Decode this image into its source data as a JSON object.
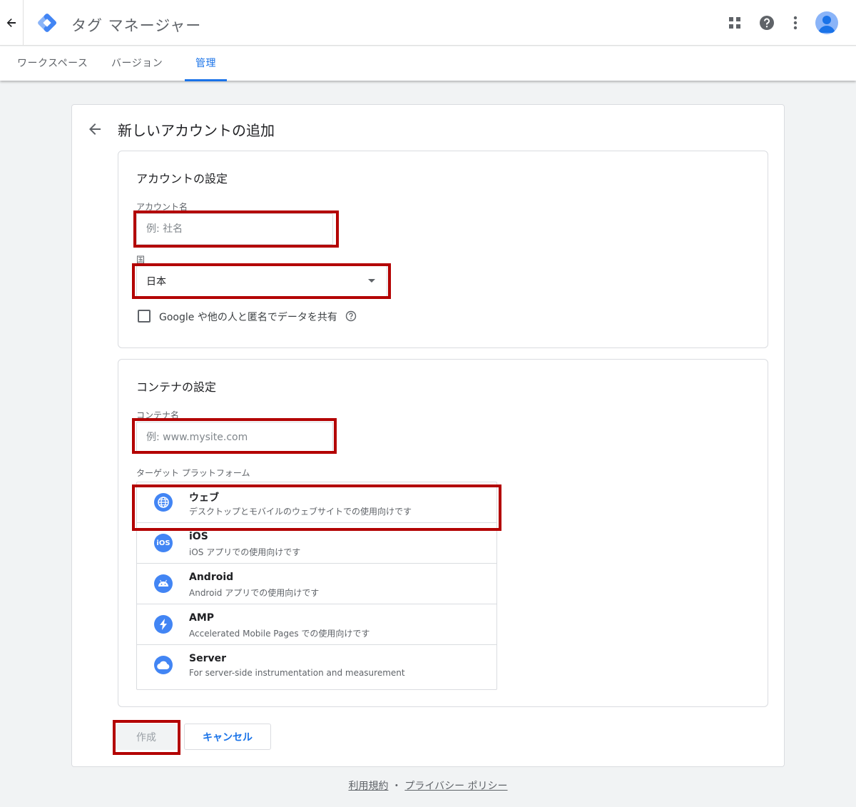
{
  "header": {
    "app_title": "タグ マネージャー",
    "icons": [
      "back-arrow-icon",
      "tag-manager-logo",
      "apps-grid-icon",
      "help-icon",
      "more-vert-icon",
      "avatar"
    ]
  },
  "tabs": [
    {
      "label": "ワークスペース",
      "active": false
    },
    {
      "label": "バージョン",
      "active": false
    },
    {
      "label": "管理",
      "active": true
    }
  ],
  "page": {
    "title": "新しいアカウントの追加"
  },
  "account_section": {
    "title": "アカウントの設定",
    "account_name_label": "アカウント名",
    "account_name_value": "",
    "account_name_placeholder": "例: 社名",
    "country_label": "国",
    "country_value": "日本",
    "share_label": "Google や他の人と匿名でデータを共有",
    "share_checked": false
  },
  "container_section": {
    "title": "コンテナの設定",
    "container_name_label": "コンテナ名",
    "container_name_value": "",
    "container_name_placeholder": "例: www.mysite.com",
    "platform_label": "ターゲット プラットフォーム",
    "platforms": [
      {
        "name": "ウェブ",
        "desc": "デスクトップとモバイルのウェブサイトでの使用向けです",
        "icon": "globe-icon"
      },
      {
        "name": "iOS",
        "desc": "iOS アプリでの使用向けです",
        "icon": "ios-icon"
      },
      {
        "name": "Android",
        "desc": "Android アプリでの使用向けです",
        "icon": "android-icon"
      },
      {
        "name": "AMP",
        "desc": "Accelerated Mobile Pages での使用向けです",
        "icon": "amp-bolt-icon"
      },
      {
        "name": "Server",
        "desc": "For server-side instrumentation and measurement",
        "icon": "cloud-icon"
      }
    ]
  },
  "actions": {
    "create_label": "作成",
    "cancel_label": "キャンセル"
  },
  "footer": {
    "terms": "利用規約",
    "separator": "・",
    "privacy": "プライバシー ポリシー"
  },
  "colors": {
    "accent": "#1a73e8",
    "highlight": "#b30000",
    "icon_blue": "#4285f4"
  }
}
